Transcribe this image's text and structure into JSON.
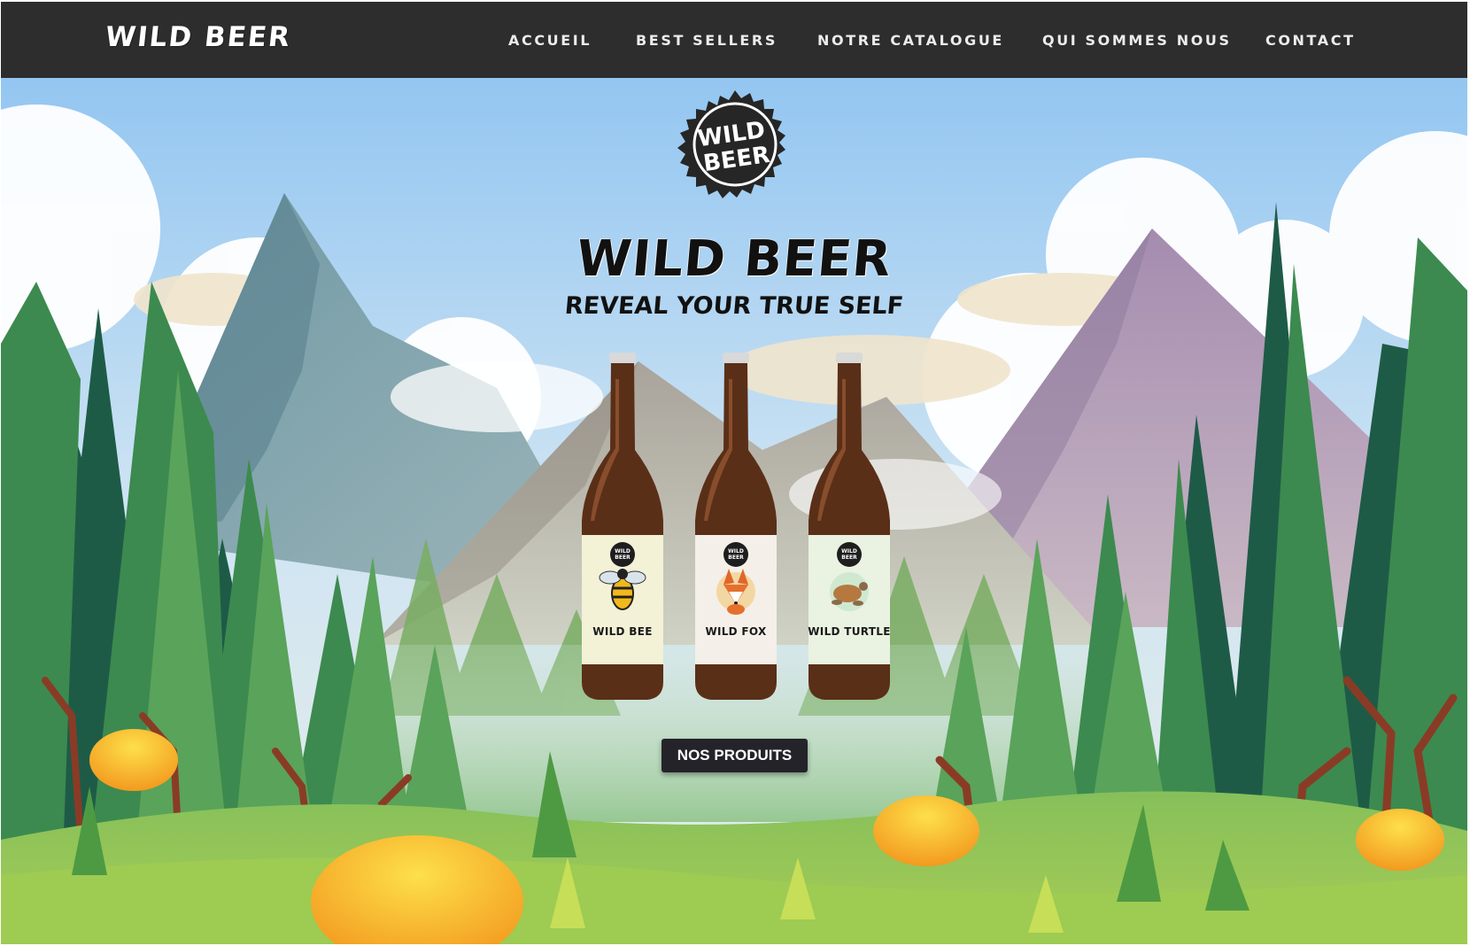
{
  "nav": {
    "brand": "WILD BEER",
    "items": [
      {
        "label": "ACCUEIL"
      },
      {
        "label": "BEST SELLERS"
      },
      {
        "label": "NOTRE CATALOGUE"
      },
      {
        "label": "QUI SOMMES NOUS"
      },
      {
        "label": "CONTACT"
      }
    ]
  },
  "hero": {
    "badge_line1": "WILD",
    "badge_line2": "BEER",
    "title": "WILD BEER",
    "subtitle": "REVEAL YOUR TRUE SELF",
    "cta_label": "NOS PRODUITS",
    "products": [
      {
        "name": "WILD BEE",
        "icon": "bee-icon",
        "label_color": "#f3f1d6"
      },
      {
        "name": "WILD FOX",
        "icon": "fox-icon",
        "label_color": "#f4efe8"
      },
      {
        "name": "WILD TURTLE",
        "icon": "turtle-icon",
        "label_color": "#eaf2e2"
      }
    ]
  },
  "colors": {
    "nav_bg": "#2e2d2d",
    "sky": "#a8d2f4",
    "forest_dark": "#1f5d44",
    "forest_light": "#7cb84e",
    "button_bg": "#24232a"
  }
}
